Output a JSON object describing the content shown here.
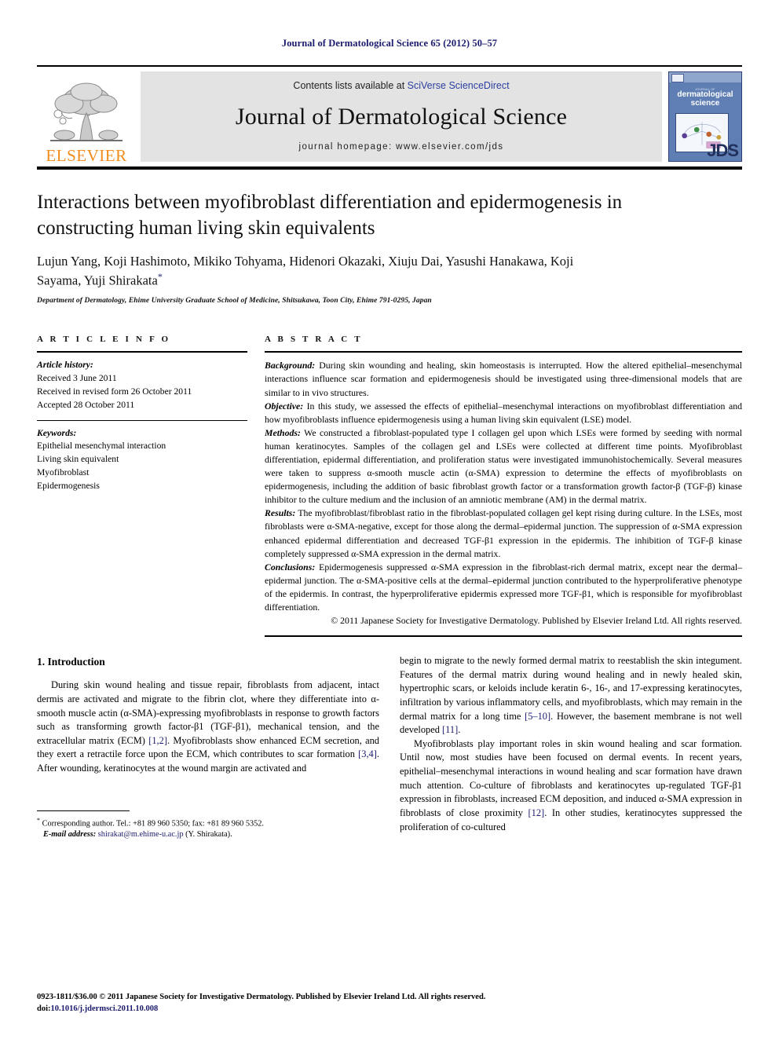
{
  "running_head": "Journal of Dermatological Science 65 (2012) 50–57",
  "masthead": {
    "publisher_wordmark": "ELSEVIER",
    "contents_prefix": "Contents lists available at",
    "contents_link": "SciVerse ScienceDirect",
    "journal_title": "Journal of Dermatological Science",
    "homepage": "journal homepage: www.elsevier.com/jds",
    "cover": {
      "small_title": "JOURNAL OF",
      "main_title": "dermatological science",
      "logo_text": "JDS"
    },
    "accent_orange": "#F08C1E",
    "link_blue": "#2b3ea0"
  },
  "article": {
    "title": "Interactions between myofibroblast differentiation and epidermogenesis in constructing human living skin equivalents",
    "authors": "Lujun Yang, Koji Hashimoto, Mikiko Tohyama, Hidenori Okazaki, Xiuju Dai, Yasushi Hanakawa, Koji Sayama, Yuji Shirakata",
    "corresponding_marker": "*",
    "affiliation": "Department of Dermatology, Ehime University Graduate School of Medicine, Shitsukawa, Toon City, Ehime 791-0295, Japan"
  },
  "article_info": {
    "heading": "A R T I C L E   I N F O",
    "history_label": "Article history:",
    "history": [
      "Received 3 June 2011",
      "Received in revised form 26 October 2011",
      "Accepted 28 October 2011"
    ],
    "keywords_label": "Keywords:",
    "keywords": [
      "Epithelial mesenchymal interaction",
      "Living skin equivalent",
      "Myofibroblast",
      "Epidermogenesis"
    ]
  },
  "abstract": {
    "heading": "A B S T R A C T",
    "sections": [
      {
        "label": "Background:",
        "text": " During skin wounding and healing, skin homeostasis is interrupted. How the altered epithelial–mesenchymal interactions influence scar formation and epidermogenesis should be investigated using three-dimensional models that are similar to in vivo structures."
      },
      {
        "label": "Objective:",
        "text": " In this study, we assessed the effects of epithelial–mesenchymal interactions on myofibroblast differentiation and how myofibroblasts influence epidermogenesis using a human living skin equivalent (LSE) model."
      },
      {
        "label": "Methods:",
        "text": " We constructed a fibroblast-populated type I collagen gel upon which LSEs were formed by seeding with normal human keratinocytes. Samples of the collagen gel and LSEs were collected at different time points. Myofibroblast differentiation, epidermal differentiation, and proliferation status were investigated immunohistochemically. Several measures were taken to suppress α-smooth muscle actin (α-SMA) expression to determine the effects of myofibroblasts on epidermogenesis, including the addition of basic fibroblast growth factor or a transformation growth factor-β (TGF-β) kinase inhibitor to the culture medium and the inclusion of an amniotic membrane (AM) in the dermal matrix."
      },
      {
        "label": "Results:",
        "text": " The myofibroblast/fibroblast ratio in the fibroblast-populated collagen gel kept rising during culture. In the LSEs, most fibroblasts were α-SMA-negative, except for those along the dermal–epidermal junction. The suppression of α-SMA expression enhanced epidermal differentiation and decreased TGF-β1 expression in the epidermis. The inhibition of TGF-β kinase completely suppressed α-SMA expression in the dermal matrix."
      },
      {
        "label": "Conclusions:",
        "text": " Epidermogenesis suppressed α-SMA expression in the fibroblast-rich dermal matrix, except near the dermal–epidermal junction. The α-SMA-positive cells at the dermal–epidermal junction contributed to the hyperproliferative phenotype of the epidermis. In contrast, the hyperproliferative epidermis expressed more TGF-β1, which is responsible for myofibroblast differentiation."
      }
    ],
    "copyright": "© 2011 Japanese Society for Investigative Dermatology. Published by Elsevier Ireland Ltd. All rights reserved."
  },
  "body": {
    "section_heading": "1. Introduction",
    "left_paragraph_1_a": "During skin wound healing and tissue repair, fibroblasts from adjacent, intact dermis are activated and migrate to the fibrin clot, where they differentiate into α-smooth muscle actin (α-SMA)-expressing myofibroblasts in response to growth factors such as transforming growth factor-β1 (TGF-β1), mechanical tension, and the extracellular matrix (ECM) ",
    "left_ref_1": "[1,2]",
    "left_paragraph_1_b": ". Myofibroblasts show enhanced ECM secretion, and they exert a retractile force upon the ECM, which contributes to scar formation ",
    "left_ref_2": "[3,4]",
    "left_paragraph_1_c": ". After wounding, keratinocytes at the wound margin are activated and",
    "right_paragraph_1_a": "begin to migrate to the newly formed dermal matrix to reestablish the skin integument. Features of the dermal matrix during wound healing and in newly healed skin, hypertrophic scars, or keloids include keratin 6-, 16-, and 17-expressing keratinocytes, infiltration by various inflammatory cells, and myofibroblasts, which may remain in the dermal matrix for a long time ",
    "right_ref_1": "[5–10]",
    "right_paragraph_1_b": ". However, the basement membrane is not well developed ",
    "right_ref_2": "[11]",
    "right_paragraph_1_c": ".",
    "right_paragraph_2_a": "Myofibroblasts play important roles in skin wound healing and scar formation. Until now, most studies have been focused on dermal events. In recent years, epithelial–mesenchymal interactions in wound healing and scar formation have drawn much attention. Co-culture of fibroblasts and keratinocytes up-regulated TGF-β1 expression in fibroblasts, increased ECM deposition, and induced α-SMA expression in fibroblasts of close proximity ",
    "right_ref_3": "[12]",
    "right_paragraph_2_b": ". In other studies, keratinocytes suppressed the proliferation of co-cultured"
  },
  "footnote": {
    "marker": "*",
    "corresponding": "Corresponding author. Tel.: +81 89 960 5350; fax: +81 89 960 5352.",
    "email_label": "E-mail address:",
    "email": "shirakat@m.ehime-u.ac.jp",
    "email_suffix": "(Y. Shirakata)."
  },
  "page_footer": {
    "line1": "0923-1811/$36.00 © 2011 Japanese Society for Investigative Dermatology. Published by Elsevier Ireland Ltd. All rights reserved.",
    "doi_prefix": "doi:",
    "doi": "10.1016/j.jdermsci.2011.10.008"
  }
}
